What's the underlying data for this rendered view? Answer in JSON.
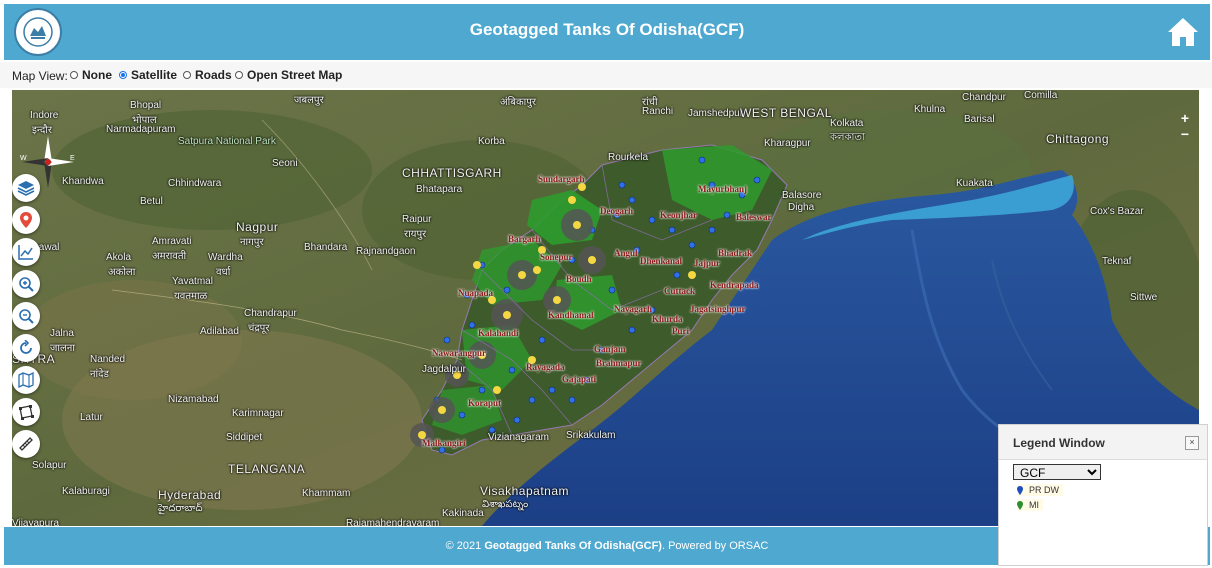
{
  "header": {
    "title": "Geotagged Tanks Of Odisha(GCF)",
    "logo_icon": "odisha-emblem-icon",
    "home_icon": "home-icon"
  },
  "map_view": {
    "label": "Map View:",
    "options": [
      "None",
      "Satellite",
      "Roads",
      "Open Street Map"
    ],
    "selected": "Satellite"
  },
  "map_controls": {
    "zoom_in": "+",
    "zoom_out": "−",
    "tool_icons": [
      "layers-icon",
      "location-pin-icon",
      "chart-icon",
      "zoom-in-icon",
      "zoom-out-icon",
      "refresh-icon",
      "map-icon",
      "polygon-draw-icon",
      "measure-ruler-icon"
    ]
  },
  "map_labels": {
    "places": [
      "Indore",
      "इन्दौर",
      "Bhopal",
      "भोपाल",
      "Narmadapuram",
      "जबलपुर",
      "अंबिकापुर",
      "रांची",
      "Ranchi",
      "Jamshedpur",
      "WEST BENGAL",
      "Kolkata",
      "কলকাতা",
      "Kharagpur",
      "Khulna",
      "Chandpur",
      "Comilla",
      "Barisal",
      "Chittagong",
      "Satpura National Park",
      "Seoni",
      "Korba",
      "CHHATTISGARH",
      "Bhatapara",
      "Raipur",
      "रायपुर",
      "Rourkela",
      "Khandwa",
      "Betul",
      "Chhindwara",
      "Nagpur",
      "नागपुर",
      "Bhandara",
      "Rajnandgaon",
      "Bhusawal",
      "Amravati",
      "अमरावती",
      "Akola",
      "अकोला",
      "Wardha",
      "वर्धा",
      "Yavatmal",
      "यवतमाळ",
      "Chandrapur",
      "चंद्रपूर",
      "Adilabad",
      "Jalna",
      "जालना",
      "SHTRA",
      "Nanded",
      "नांदेड",
      "Nizamabad",
      "Karimnagar",
      "Latur",
      "Siddipet",
      "TELANGANA",
      "Solapur",
      "Hyderabad",
      "హైదరాబాద్",
      "Khammam",
      "Vijayapura",
      "Kalaburagi",
      "Visakhapatnam",
      "విశాఖపట్నం",
      "Vizianagaram",
      "Srikakulam",
      "Rajamahendravaram",
      "Kakinada",
      "Kuakata",
      "Cox's Bazar",
      "Teknaf",
      "Sittwe",
      "Jagdalpur",
      "Balasore",
      "Digha"
    ],
    "districts": [
      "Sundargarh",
      "Deogarh",
      "Mayurbhanj",
      "Keonjhar",
      "Baleswar",
      "Bargarh",
      "Sonepur",
      "Angul",
      "Dhenkanal",
      "Jajpur",
      "Bhadrak",
      "Boudh",
      "Cuttack",
      "Kendrapada",
      "Nuapada",
      "Kandhamal",
      "Nayagarh",
      "Khurda",
      "Jagatsinghpur",
      "Kalahandi",
      "Puri",
      "Nawarangpur",
      "Ganjam",
      "Rayagada",
      "Brahmapur",
      "Koraput",
      "Gajapati",
      "Malkangiri"
    ]
  },
  "legend": {
    "title": "Legend Window",
    "close_label": "×",
    "select_value": "GCF",
    "items": [
      {
        "label": "PR DW",
        "color": "#1f4fbf"
      },
      {
        "label": "MI",
        "color": "#2f8f2f"
      }
    ]
  },
  "footer": {
    "copyright": "© 2021",
    "name": "Geotagged Tanks Of Odisha(GCF)",
    "powered": ". Powered by ORSAC"
  }
}
